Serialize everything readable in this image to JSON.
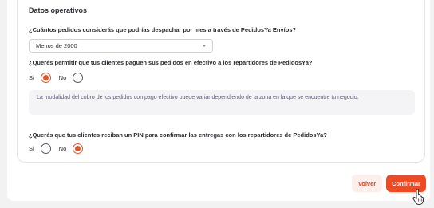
{
  "section": {
    "title": "Datos operativos"
  },
  "questions": {
    "orders_per_month": {
      "label": "¿Cuántos pedidos considerás que podrías despachar por mes a través de PedidosYa Envíos?",
      "selected": "Menos de 2000"
    },
    "cash_payment": {
      "label": "¿Querés permitir que tus clientes paguen sus pedidos en efectivo a los repartidores de PedidosYa?",
      "options": [
        {
          "label": "Si",
          "checked": true
        },
        {
          "label": "No",
          "checked": false
        }
      ],
      "info": "La modalidad del cobro de los pedidos con pago efectivo puede variar dependiendo de la zona en la que se encuentre tu negocio."
    },
    "pin_confirmation": {
      "label": "¿Querés que tus clientes reciban un PIN para confirmar las entregas con los repartidores de PedidosYa?",
      "options": [
        {
          "label": "Si",
          "checked": false
        },
        {
          "label": "No",
          "checked": true
        }
      ]
    }
  },
  "actions": {
    "back_label": "Volver",
    "confirm_label": "Confirmar"
  },
  "icons": {
    "select_caret": "chevron-down-icon",
    "cursor": "hand-pointer-icon"
  },
  "colors": {
    "accent": "#ee4a24",
    "radio_checked": "#e2542a",
    "secondary_button_bg": "#fdeee9",
    "info_text": "#5c5c7a"
  }
}
